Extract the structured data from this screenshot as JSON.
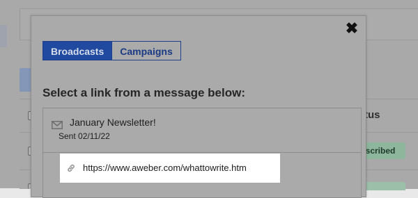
{
  "background": {
    "status_header": "tus",
    "status_badge": "Subscribed"
  },
  "modal": {
    "close_label": "✖",
    "tabs": [
      {
        "label": "Broadcasts",
        "active": true
      },
      {
        "label": "Campaigns",
        "active": false
      }
    ],
    "heading": "Select a link from a message below:",
    "message": {
      "title": "January Newsletter!",
      "sent": "Sent 02/11/22",
      "link": "https://www.aweber.com/whattowrite.htm"
    }
  },
  "colors": {
    "accent": "#1f4aa0",
    "highlight": "#ffffff",
    "badge": "#8db69d"
  },
  "icons": {
    "close": "close-icon",
    "envelope": "envelope-icon",
    "link": "link-icon"
  }
}
